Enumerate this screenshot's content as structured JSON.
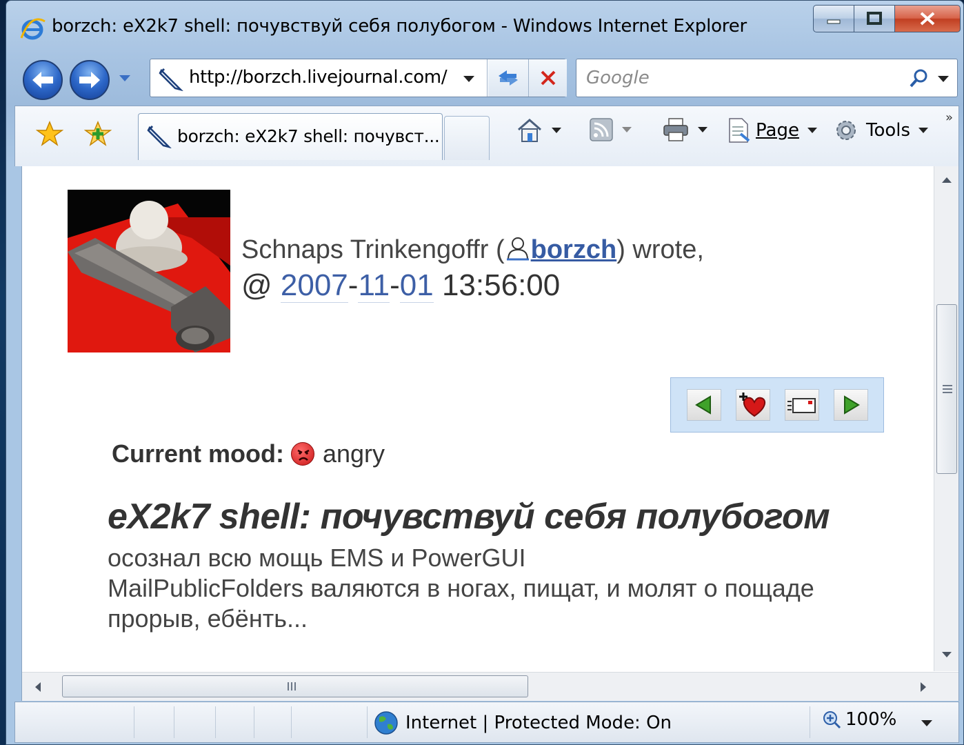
{
  "window": {
    "title": "borzch: eX2k7 shell: почувствуй себя полубогом - Windows Internet Explorer"
  },
  "address": {
    "url": "http://borzch.livejournal.com/"
  },
  "search": {
    "placeholder": "Google"
  },
  "tab": {
    "label": "borzch: eX2k7 shell: почувст..."
  },
  "commands": {
    "page": "Page",
    "tools": "Tools"
  },
  "post": {
    "author_name": "Schnaps Trinkengoffr (",
    "username": "borzch",
    "wrote": ") wrote,",
    "at": "@ ",
    "year": "2007",
    "month": "11",
    "day": "01",
    "time": " 13:56:00",
    "mood_label": "Current mood:",
    "mood_value": "angry",
    "title": "eX2k7 shell: почувствуй себя полубогом",
    "body": [
      "осознал всю мощь EMS и PowerGUI",
      "MailPublicFolders валяются в ногах, пищат, и молят о пощаде",
      "прорыв, ебёнть..."
    ]
  },
  "status": {
    "zone": "Internet | Protected Mode: On",
    "zoom": "100%"
  },
  "colors": {
    "link": "#365ba3",
    "navbox_bg": "#cfe3f7",
    "mood_face": "#c81515"
  }
}
